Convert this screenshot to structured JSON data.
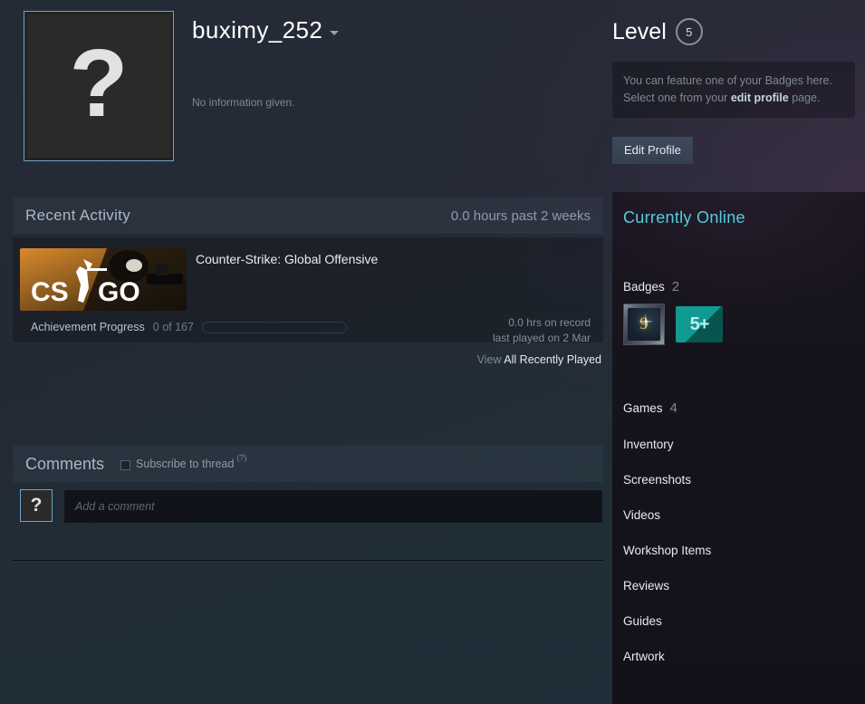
{
  "profile": {
    "persona_name": "buximy_252",
    "summary": "No information given.",
    "avatar_glyph": "?",
    "dropdown_icon": "chevron-down-icon"
  },
  "level": {
    "label": "Level",
    "value": "5",
    "feature_text_before": "You can feature one of your Badges here. Select one from your ",
    "feature_link": "edit profile",
    "feature_text_after": " page.",
    "edit_profile_button": "Edit Profile"
  },
  "recent_activity": {
    "title": "Recent Activity",
    "hours_summary": "0.0 hours past 2 weeks",
    "game": {
      "name": "Counter-Strike: Global Offensive",
      "capsule_text_left": "CS",
      "capsule_text_right": "GO",
      "hours_on_record": "0.0 hrs on record",
      "last_played": "last played on 2 Mar",
      "achievement_label": "Achievement Progress",
      "achievement_count": "0 of 167",
      "achievement_percent": 0
    },
    "view_all_dim": "View",
    "view_all_lit": "All Recently Played"
  },
  "comments": {
    "title": "Comments",
    "subscribe_label": "Subscribe to thread",
    "subscribe_checked": false,
    "help_glyph": "(?)",
    "compose_avatar_glyph": "?",
    "compose_placeholder": "Add a comment"
  },
  "sidebar": {
    "online_status": "Currently Online",
    "badges": {
      "label": "Badges",
      "count": "2",
      "items": [
        {
          "name": "level-badge",
          "value": "9",
          "style": "framed"
        },
        {
          "name": "games-badge",
          "value": "5+",
          "style": "flat"
        }
      ]
    },
    "links": [
      {
        "label": "Games",
        "count": "4"
      },
      {
        "label": "Inventory",
        "count": ""
      },
      {
        "label": "Screenshots",
        "count": ""
      },
      {
        "label": "Videos",
        "count": ""
      },
      {
        "label": "Workshop Items",
        "count": ""
      },
      {
        "label": "Reviews",
        "count": ""
      },
      {
        "label": "Guides",
        "count": ""
      },
      {
        "label": "Artwork",
        "count": ""
      }
    ]
  },
  "colors": {
    "accent_cyan": "#57cbde",
    "avatar_border": "#6fa4c4",
    "page_bg": "#1b2838",
    "badge_teal": "#0f9b92",
    "badge_gold": "#d7b44e"
  }
}
